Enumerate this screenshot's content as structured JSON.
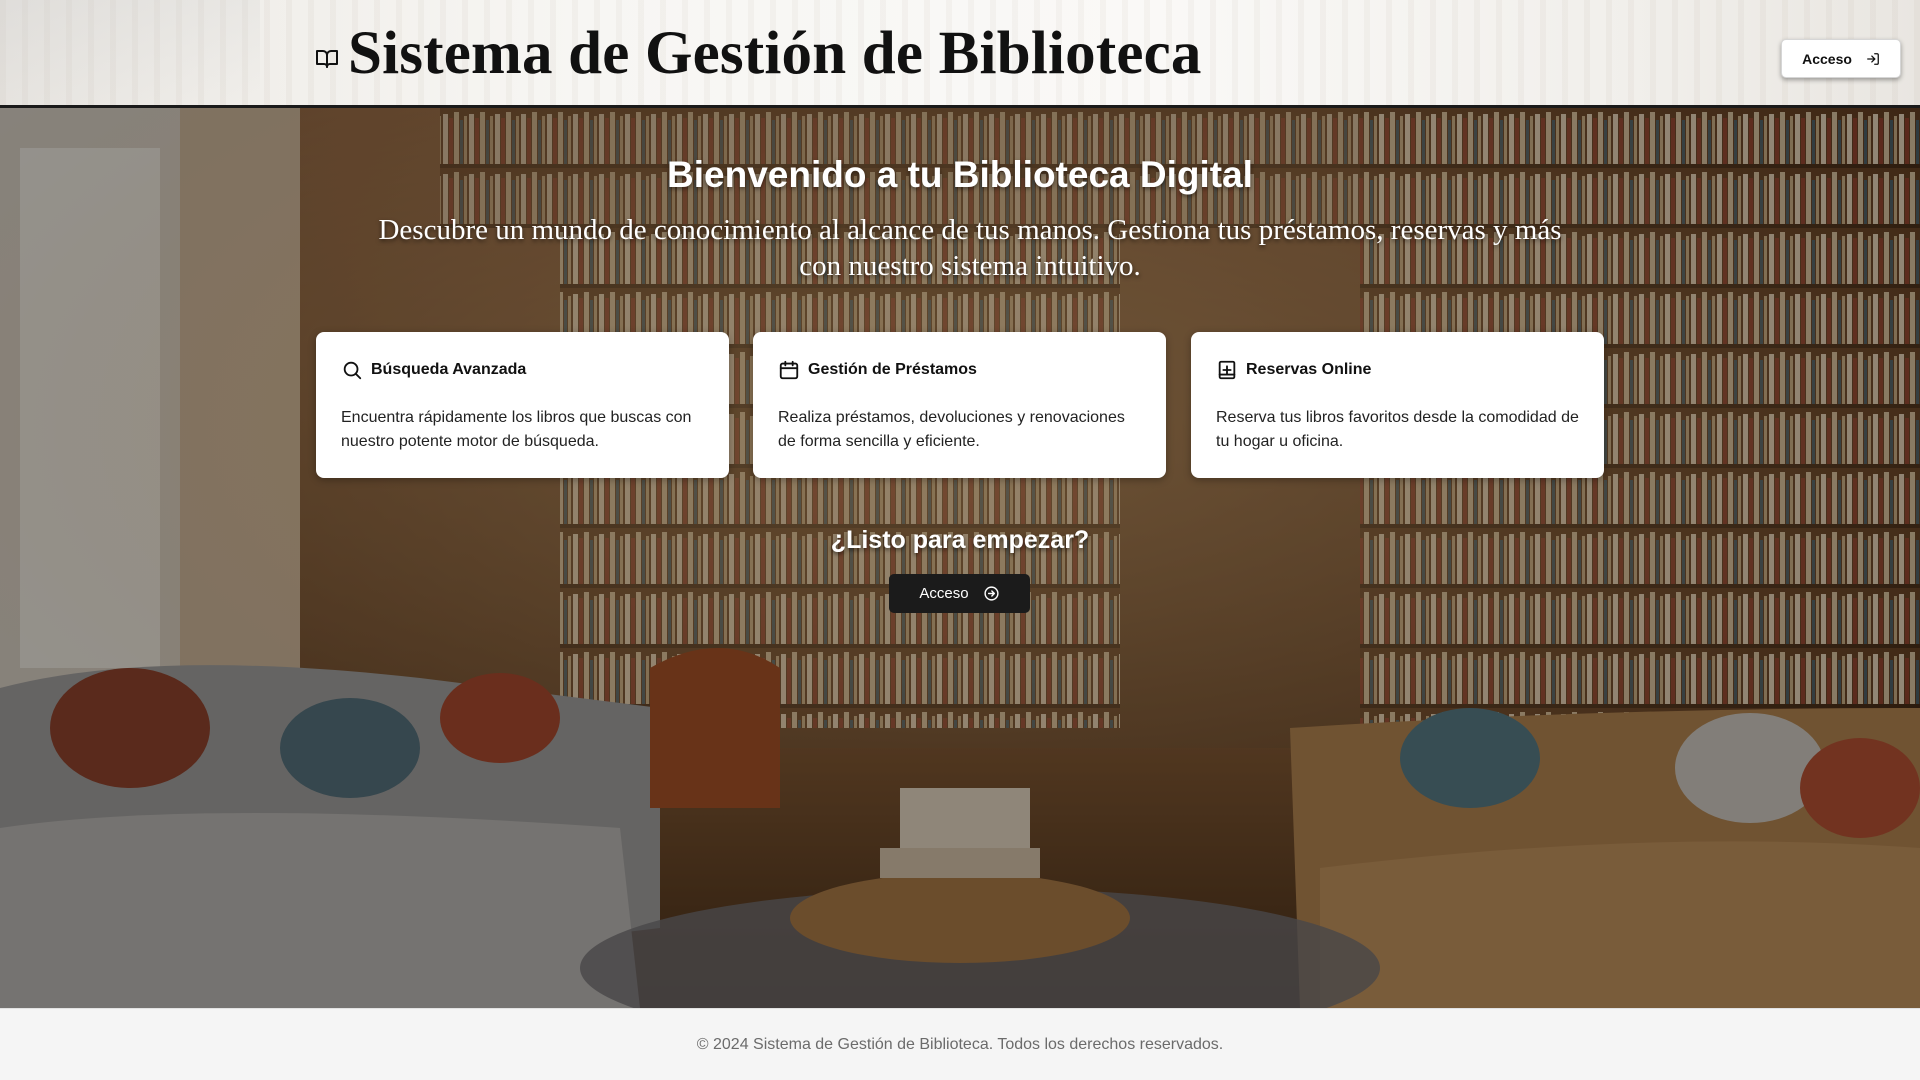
{
  "header": {
    "title": "Sistema de Gestión de Biblioteca",
    "brand_icon": "open-book-icon",
    "login_label": "Acceso",
    "login_icon": "login-arrow-icon"
  },
  "hero": {
    "title": "Bienvenido a tu Biblioteca Digital",
    "subtitle": "Descubre un mundo de conocimiento al alcance de tus manos. Gestiona tus préstamos, reservas y más con nuestro sistema intuitivo.",
    "background": "library-living-room-photo"
  },
  "features": [
    {
      "icon": "search-icon",
      "title": "Búsqueda Avanzada",
      "text": "Encuentra rápidamente los libros que buscas con nuestro potente motor de búsqueda."
    },
    {
      "icon": "calendar-icon",
      "title": "Gestión de Préstamos",
      "text": "Realiza préstamos, devoluciones y renovaciones de forma sencilla y eficiente."
    },
    {
      "icon": "book-plus-icon",
      "title": "Reservas Online",
      "text": "Reserva tus libros favoritos desde la comodidad de tu hogar u oficina."
    }
  ],
  "cta": {
    "title": "¿Listo para empezar?",
    "button_label": "Acceso",
    "button_icon": "arrow-right-circle-icon"
  },
  "footer": {
    "copyright": "© 2024 Sistema de Gestión de Biblioteca. Todos los derechos reservados."
  },
  "colors": {
    "header_bg": "#f7f6f3",
    "dark_button": "#1b1b1b",
    "footer_bg": "#f5f5f5",
    "footer_text": "#6b6b6b"
  }
}
